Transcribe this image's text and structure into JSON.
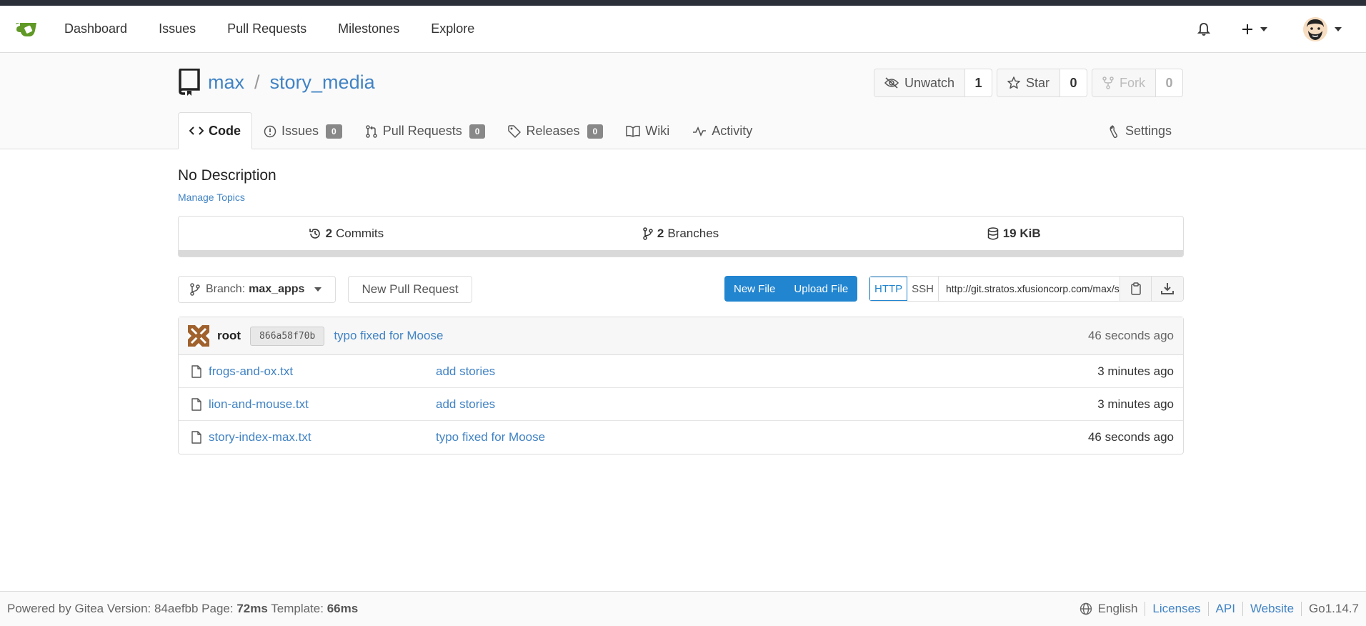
{
  "nav": {
    "items": [
      "Dashboard",
      "Issues",
      "Pull Requests",
      "Milestones",
      "Explore"
    ]
  },
  "repo": {
    "owner": "max",
    "separator": "/",
    "name": "story_media",
    "watch_label": "Unwatch",
    "watch_count": "1",
    "star_label": "Star",
    "star_count": "0",
    "fork_label": "Fork",
    "fork_count": "0"
  },
  "tabs": {
    "code": "Code",
    "issues": "Issues",
    "issues_count": "0",
    "pulls": "Pull Requests",
    "pulls_count": "0",
    "releases": "Releases",
    "releases_count": "0",
    "wiki": "Wiki",
    "activity": "Activity",
    "settings": "Settings"
  },
  "description": "No Description",
  "manage_topics": "Manage Topics",
  "stats": {
    "commits_count": "2",
    "commits_label": "Commits",
    "branches_count": "2",
    "branches_label": "Branches",
    "size": "19 KiB"
  },
  "toolbar": {
    "branch_prefix": "Branch:",
    "branch_name": "max_apps",
    "new_pr": "New Pull Request",
    "new_file": "New File",
    "upload_file": "Upload File",
    "http": "HTTP",
    "ssh": "SSH",
    "clone_url": "http://git.stratos.xfusioncorp.com/max/story_media.git"
  },
  "latest_commit": {
    "author": "root",
    "sha": "866a58f70b",
    "message": "typo fixed for Moose",
    "time": "46 seconds ago"
  },
  "files": [
    {
      "name": "frogs-and-ox.txt",
      "message": "add stories",
      "time": "3 minutes ago"
    },
    {
      "name": "lion-and-mouse.txt",
      "message": "add stories",
      "time": "3 minutes ago"
    },
    {
      "name": "story-index-max.txt",
      "message": "typo fixed for Moose",
      "time": "46 seconds ago"
    }
  ],
  "footer": {
    "powered_prefix": "Powered by Gitea Version: 84aefbb Page:",
    "page_time": "72ms",
    "template_label": "Template:",
    "template_time": "66ms",
    "language": "English",
    "licenses": "Licenses",
    "api": "API",
    "website": "Website",
    "go_version": "Go1.14.7"
  },
  "colors": {
    "accent": "#4183c4",
    "primary_button": "#2185d0",
    "gitea_green": "#609926"
  }
}
